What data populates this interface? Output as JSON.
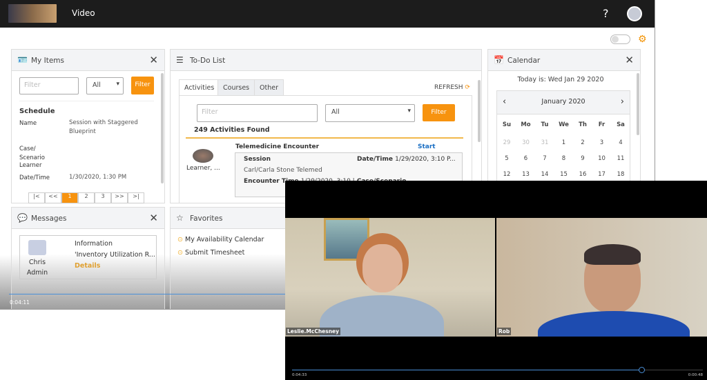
{
  "app": {
    "title": "Video",
    "help": "?",
    "gear": "gear-icon"
  },
  "my_items": {
    "title": "My Items",
    "filter_placeholder": "Filter",
    "select": "All",
    "filter_btn": "Filter",
    "section": "Schedule",
    "fields": [
      {
        "label": "Name",
        "value": "Session with Staggered Blueprint"
      },
      {
        "label": "Case/ Scenario",
        "value": ""
      },
      {
        "label": "Learner",
        "value": ""
      },
      {
        "label": "Date/Time",
        "value": "1/30/2020, 1:30 PM"
      }
    ],
    "pages": [
      "|<",
      "<<",
      "1",
      "2",
      "3",
      ">>",
      ">|"
    ]
  },
  "todo": {
    "title": "To-Do List",
    "tabs": [
      "Activities",
      "Courses",
      "Other"
    ],
    "refresh": "REFRESH",
    "filter_placeholder": "Filter",
    "select": "All",
    "filter_btn": "Filter",
    "found": "249 Activities Found",
    "item": {
      "title": "Telemedicine Encounter",
      "action": "Start",
      "learner": "Learner, ...",
      "session_label": "Session",
      "session_value": "Carl/Carla Stone Telemed",
      "datetime_label": "Date/Time",
      "datetime_value": "1/29/2020, 3:10 P...",
      "encounter_label": "Encounter Time",
      "encounter_value": "1/29/2020, 3:10 |",
      "case_label": "Case/Scenario"
    }
  },
  "calendar": {
    "title": "Calendar",
    "today": "Today is: Wed Jan 29 2020",
    "month": "January 2020",
    "days": [
      "Su",
      "Mo",
      "Tu",
      "We",
      "Th",
      "Fr",
      "Sa"
    ],
    "weeks": [
      [
        "29",
        "30",
        "31",
        "1",
        "2",
        "3",
        "4"
      ],
      [
        "5",
        "6",
        "7",
        "8",
        "9",
        "10",
        "11"
      ],
      [
        "12",
        "13",
        "14",
        "15",
        "16",
        "17",
        "18"
      ]
    ]
  },
  "messages": {
    "title": "Messages",
    "sender_first": "Chris",
    "sender_last": "Admin",
    "type": "Information",
    "subject": "'Inventory Utilization R...",
    "details": "Details"
  },
  "favorites": {
    "title": "Favorites",
    "items": [
      "My Availability Calendar",
      "Submit Timesheet"
    ]
  },
  "back_player": {
    "time": "0:04:11"
  },
  "video": {
    "participants": [
      "Leslie.McChesney",
      "Rob"
    ],
    "time_left": "0:04:33",
    "time_right": "0:00:48",
    "progress": 0.85
  },
  "colors": {
    "accent": "#f7930f",
    "link": "#1a6fc4",
    "topbar": "#1c1c1c"
  }
}
